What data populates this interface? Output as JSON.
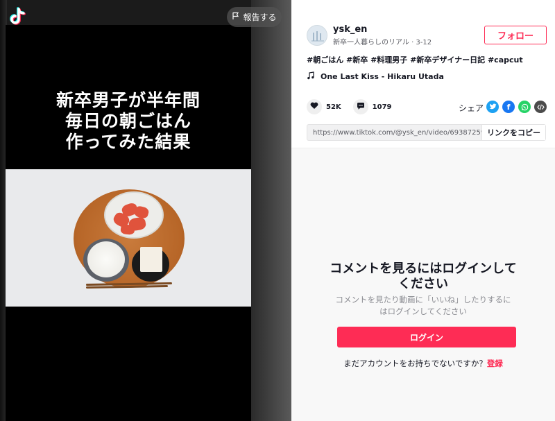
{
  "colors": {
    "brand": "#fe2c55",
    "text": "#161823",
    "muted": "#5b5c63"
  },
  "header": {
    "report_label": "報告する"
  },
  "video": {
    "caption_lines": [
      "新卒男子が半年間",
      "毎日の朝ごはん",
      "作ってみた結果"
    ]
  },
  "author": {
    "username": "ysk_en",
    "subtitle": "新卒一人暮らしのリアル · 3-12",
    "follow_label": "フォロー"
  },
  "post": {
    "hashtags": "#朝ごはん #新卒 #料理男子 #新卒デザイナー日記 #capcut",
    "music": "One Last Kiss - Hikaru Utada",
    "likes": "52K",
    "comments": "1079",
    "share_label": "シェア",
    "link_url": "https://www.tiktok.com/@ysk_en/video/693872592...",
    "copy_label": "リンクをコピー"
  },
  "login": {
    "title_line1": "コメントを見るにはログインして",
    "title_line2": "ください",
    "desc_line1": "コメントを見たり動画に「いいね」したりするに",
    "desc_line2": "はログインしてください",
    "button": "ログイン",
    "signup_prompt": "まだアカウントをお持ちでないですか？",
    "signup_link": "登録"
  }
}
